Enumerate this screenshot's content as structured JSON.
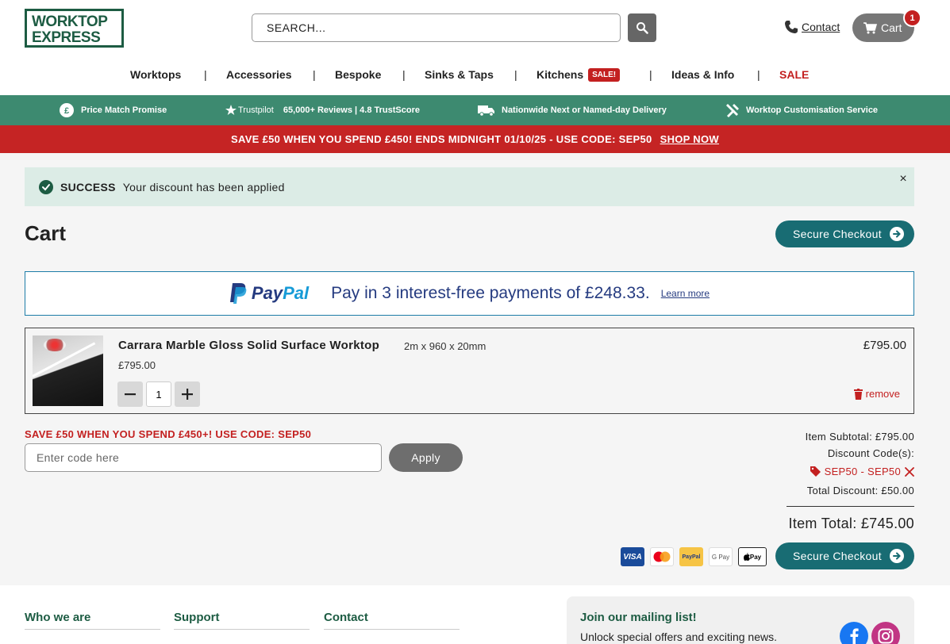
{
  "header": {
    "logo_line1": "WORKTOP",
    "logo_line2": "EXPRESS",
    "search_placeholder": "SEARCH...",
    "contact_label": "Contact",
    "cart_label": "Cart",
    "cart_count": "1"
  },
  "nav": {
    "items": [
      "Worktops",
      "Accessories",
      "Bespoke",
      "Sinks & Taps",
      "Kitchens",
      "Ideas & Info",
      "SALE"
    ],
    "separator": "|",
    "sale_badge": "SALE!"
  },
  "usp": {
    "price_match": "Price Match Promise",
    "trustpilot_label": "Trustpilot",
    "reviews": "65,000+ Reviews | 4.8 TrustScore",
    "delivery": "Nationwide Next or Named-day Delivery",
    "customisation": "Worktop Customisation Service"
  },
  "promo": {
    "text": "SAVE £50 WHEN YOU SPEND £450! ENDS MIDNIGHT 01/10/25 - USE CODE: SEP50",
    "link": "SHOP NOW"
  },
  "alert": {
    "title": "SUCCESS",
    "message": "Your discount has been applied",
    "close": "×"
  },
  "page": {
    "title": "Cart",
    "checkout_label": "Secure Checkout"
  },
  "paypal": {
    "brand_a": "Pay",
    "brand_b": "Pal",
    "message": "Pay in 3 interest-free payments of £248.33.",
    "learn_more": "Learn more"
  },
  "item": {
    "name": "Carrara Marble Gloss Solid Surface Worktop",
    "dims": "2m x 960 x 20mm",
    "unit_price": "£795.00",
    "quantity": "1",
    "line_price": "£795.00",
    "remove_label": "remove"
  },
  "discount": {
    "promo_label": "SAVE £50 WHEN YOU SPEND £450+! USE CODE: SEP50",
    "placeholder": "Enter code here",
    "apply_label": "Apply"
  },
  "summary": {
    "subtotal": "Item Subtotal: £795.00",
    "codes_label": "Discount Code(s):",
    "code": "SEP50 - SEP50",
    "total_discount": "Total Discount: £50.00",
    "item_total": "Item Total: £745.00"
  },
  "payment_icons": [
    "VISA",
    "Mastercard",
    "PayPal",
    "G Pay",
    "Apple Pay"
  ],
  "footer": {
    "col1": "Who we are",
    "col2": "Support",
    "col3": "Contact",
    "mailing_title": "Join our mailing list!",
    "mailing_sub": "Unlock special offers and exciting news."
  },
  "colors": {
    "brand_green": "#1d5c43",
    "usp_green": "#3d8a70",
    "promo_red": "#c52424",
    "checkout_teal": "#186c73"
  }
}
